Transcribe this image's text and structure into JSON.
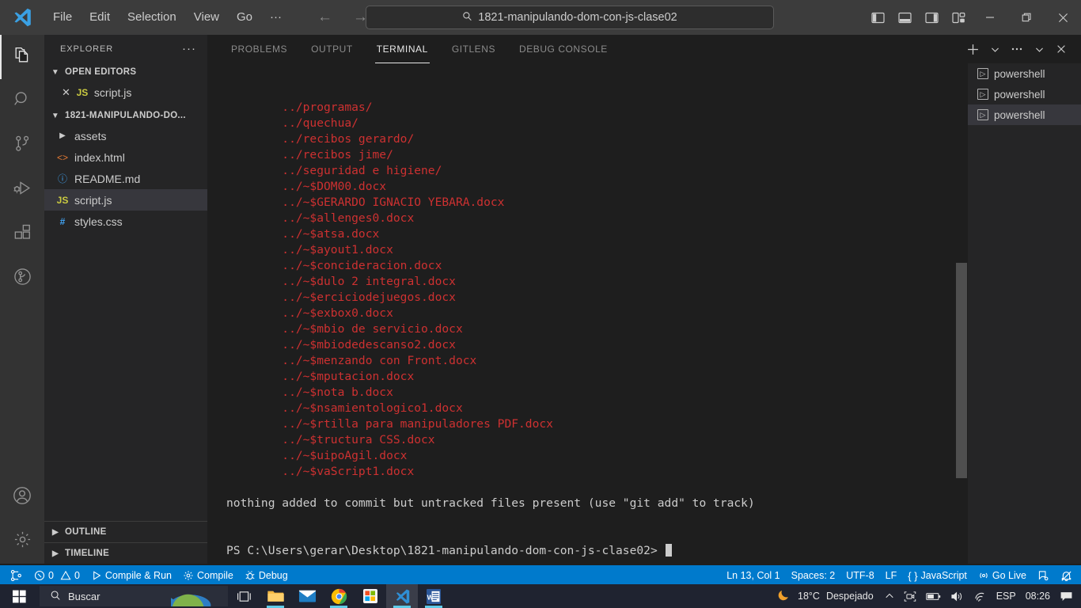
{
  "titlebar": {
    "logo_icon": "vscode-logo-icon",
    "menus": [
      "File",
      "Edit",
      "Selection",
      "View",
      "Go",
      "···"
    ],
    "back_icon": "arrow-left-icon",
    "forward_icon": "arrow-right-icon",
    "search": {
      "icon": "search-icon",
      "value": "1821-manipulando-dom-con-js-clase02"
    },
    "layout_buttons": [
      {
        "name": "toggle-primary-sidebar",
        "icon": "panel-left-icon"
      },
      {
        "name": "toggle-panel",
        "icon": "panel-bottom-icon"
      },
      {
        "name": "toggle-secondary-sidebar",
        "icon": "panel-right-icon"
      },
      {
        "name": "customize-layout",
        "icon": "layout-grid-icon"
      }
    ],
    "window_controls": [
      {
        "name": "minimize-button",
        "icon": "minimize-icon",
        "glyph": "—"
      },
      {
        "name": "maximize-button",
        "icon": "restore-icon",
        "glyph": "❐"
      },
      {
        "name": "close-button",
        "icon": "close-icon",
        "glyph": "✕"
      }
    ]
  },
  "activitybar": {
    "items": [
      {
        "name": "explorer",
        "icon": "files-icon",
        "active": true
      },
      {
        "name": "search",
        "icon": "search-icon",
        "active": false
      },
      {
        "name": "source-control",
        "icon": "source-control-icon",
        "active": false
      },
      {
        "name": "run-and-debug",
        "icon": "run-debug-icon",
        "active": false
      },
      {
        "name": "extensions",
        "icon": "extensions-icon",
        "active": false
      },
      {
        "name": "gitlens",
        "icon": "gitlens-icon",
        "active": false
      }
    ],
    "bottom": [
      {
        "name": "accounts",
        "icon": "account-icon"
      },
      {
        "name": "manage-settings",
        "icon": "gear-icon"
      }
    ]
  },
  "sidebar": {
    "title": "EXPLORER",
    "more_actions_icon": "ellipsis-icon",
    "open_editors": {
      "label": "OPEN EDITORS",
      "expanded": true,
      "items": [
        {
          "label": "script.js",
          "icon": "js-file-icon",
          "close_icon": "close-icon"
        }
      ]
    },
    "folder": {
      "label": "1821-MANIPULANDO-DO...",
      "expanded": true,
      "items": [
        {
          "label": "assets",
          "icon": "folder-icon",
          "type": "folder",
          "selected": false
        },
        {
          "label": "index.html",
          "icon": "html-file-icon",
          "type": "file",
          "selected": false
        },
        {
          "label": "README.md",
          "icon": "markdown-file-icon",
          "type": "file",
          "selected": false
        },
        {
          "label": "script.js",
          "icon": "js-file-icon",
          "type": "file",
          "selected": true
        },
        {
          "label": "styles.css",
          "icon": "css-file-icon",
          "type": "file",
          "selected": false
        }
      ]
    },
    "bottom_sections": [
      {
        "label": "OUTLINE",
        "expanded": false
      },
      {
        "label": "TIMELINE",
        "expanded": false
      }
    ]
  },
  "panel": {
    "tabs": [
      {
        "label": "PROBLEMS",
        "active": false
      },
      {
        "label": "OUTPUT",
        "active": false
      },
      {
        "label": "TERMINAL",
        "active": true
      },
      {
        "label": "GITLENS",
        "active": false
      },
      {
        "label": "DEBUG CONSOLE",
        "active": false
      }
    ],
    "actions": [
      {
        "name": "new-terminal-button",
        "icon": "plus-icon"
      },
      {
        "name": "terminal-profile-dropdown",
        "icon": "chevron-down-icon"
      },
      {
        "name": "panel-more-actions",
        "icon": "ellipsis-icon"
      },
      {
        "name": "hide-panel-button",
        "icon": "chevron-down-icon"
      },
      {
        "name": "close-panel-button",
        "icon": "close-icon"
      }
    ],
    "terminal_list": [
      {
        "label": "powershell",
        "icon": "terminal-icon",
        "selected": false
      },
      {
        "label": "powershell",
        "icon": "terminal-icon",
        "selected": false
      },
      {
        "label": "powershell",
        "icon": "terminal-icon",
        "selected": true
      }
    ],
    "terminal_colors": {
      "untracked": "#cd3131",
      "normal": "#cccccc",
      "background": "#1e1e1e"
    },
    "terminal_lines": [
      {
        "text": "        ../programas/",
        "style": "untracked"
      },
      {
        "text": "        ../quechua/",
        "style": "untracked"
      },
      {
        "text": "        ../recibos gerardo/",
        "style": "untracked"
      },
      {
        "text": "        ../recibos jime/",
        "style": "untracked"
      },
      {
        "text": "        ../seguridad e higiene/",
        "style": "untracked"
      },
      {
        "text": "        ../~$DOM00.docx",
        "style": "untracked"
      },
      {
        "text": "        ../~$GERARDO IGNACIO YEBARA.docx",
        "style": "untracked"
      },
      {
        "text": "        ../~$allenges0.docx",
        "style": "untracked"
      },
      {
        "text": "        ../~$atsa.docx",
        "style": "untracked"
      },
      {
        "text": "        ../~$ayout1.docx",
        "style": "untracked"
      },
      {
        "text": "        ../~$concideracion.docx",
        "style": "untracked"
      },
      {
        "text": "        ../~$dulo 2 integral.docx",
        "style": "untracked"
      },
      {
        "text": "        ../~$erciciodejuegos.docx",
        "style": "untracked"
      },
      {
        "text": "        ../~$exbox0.docx",
        "style": "untracked"
      },
      {
        "text": "        ../~$mbio de servicio.docx",
        "style": "untracked"
      },
      {
        "text": "        ../~$mbiodedescanso2.docx",
        "style": "untracked"
      },
      {
        "text": "        ../~$menzando con Front.docx",
        "style": "untracked"
      },
      {
        "text": "        ../~$mputacion.docx",
        "style": "untracked"
      },
      {
        "text": "        ../~$nota b.docx",
        "style": "untracked"
      },
      {
        "text": "        ../~$nsamientologico1.docx",
        "style": "untracked"
      },
      {
        "text": "        ../~$rtilla para manipuladores PDF.docx",
        "style": "untracked"
      },
      {
        "text": "        ../~$tructura CSS.docx",
        "style": "untracked"
      },
      {
        "text": "        ../~$uipoAgil.docx",
        "style": "untracked"
      },
      {
        "text": "        ../~$vaScript1.docx",
        "style": "untracked"
      },
      {
        "text": "",
        "style": "normal"
      },
      {
        "text": "nothing added to commit but untracked files present (use \"git add\" to track)",
        "style": "normal"
      }
    ],
    "prompt": "PS C:\\Users\\gerar\\Desktop\\1821-manipulando-dom-con-js-clase02> "
  },
  "statusbar": {
    "background": "#007acc",
    "left": [
      {
        "name": "remote-indicator",
        "icon": "remote-icon",
        "label": ""
      },
      {
        "name": "problems-status",
        "icon": "error-warning-icon",
        "label": "0",
        "label2": "0"
      },
      {
        "name": "compile-and-run-button",
        "icon": "play-icon",
        "label": "Compile & Run"
      },
      {
        "name": "compile-button",
        "icon": "gear-icon",
        "label": "Compile"
      },
      {
        "name": "debug-button",
        "icon": "bug-icon",
        "label": "Debug"
      }
    ],
    "right": [
      {
        "name": "cursor-position",
        "label": "Ln 13, Col 1"
      },
      {
        "name": "indentation",
        "label": "Spaces: 2"
      },
      {
        "name": "encoding",
        "label": "UTF-8"
      },
      {
        "name": "end-of-line",
        "label": "LF"
      },
      {
        "name": "language-mode",
        "icon": "braces-icon",
        "label": "JavaScript"
      },
      {
        "name": "go-live-button",
        "icon": "broadcast-icon",
        "label": "Go Live"
      },
      {
        "name": "gitlens-status",
        "icon": "gitlens-icon",
        "label": ""
      },
      {
        "name": "notifications-bell",
        "icon": "bell-dot-icon",
        "label": ""
      }
    ]
  },
  "taskbar": {
    "start_icon": "windows-start-icon",
    "search_placeholder": "Buscar",
    "search_icon": "search-icon",
    "task_view_icon": "task-view-icon",
    "apps": [
      {
        "name": "file-explorer",
        "icon": "folder-icon",
        "running": true
      },
      {
        "name": "mail",
        "icon": "mail-icon",
        "running": false
      },
      {
        "name": "google-chrome",
        "icon": "chrome-icon",
        "running": true
      },
      {
        "name": "microsoft-store",
        "icon": "store-icon",
        "running": false
      },
      {
        "name": "visual-studio-code",
        "icon": "vscode-icon",
        "running": true,
        "active": true
      },
      {
        "name": "microsoft-word",
        "icon": "word-icon",
        "running": true
      }
    ],
    "tray": {
      "weather_icon": "moon-icon",
      "temperature": "18°C",
      "condition": "Despejado",
      "chevron_icon": "chevron-up-icon",
      "icons": [
        {
          "name": "onedrive-or-meet-icon",
          "icon": "camera-icon"
        },
        {
          "name": "battery-icon",
          "icon": "battery-icon"
        },
        {
          "name": "volume-icon",
          "icon": "speaker-icon"
        },
        {
          "name": "network-icon",
          "icon": "wifi-icon"
        }
      ],
      "language": "ESP",
      "time": "08:26",
      "action_center_icon": "action-center-icon"
    }
  }
}
